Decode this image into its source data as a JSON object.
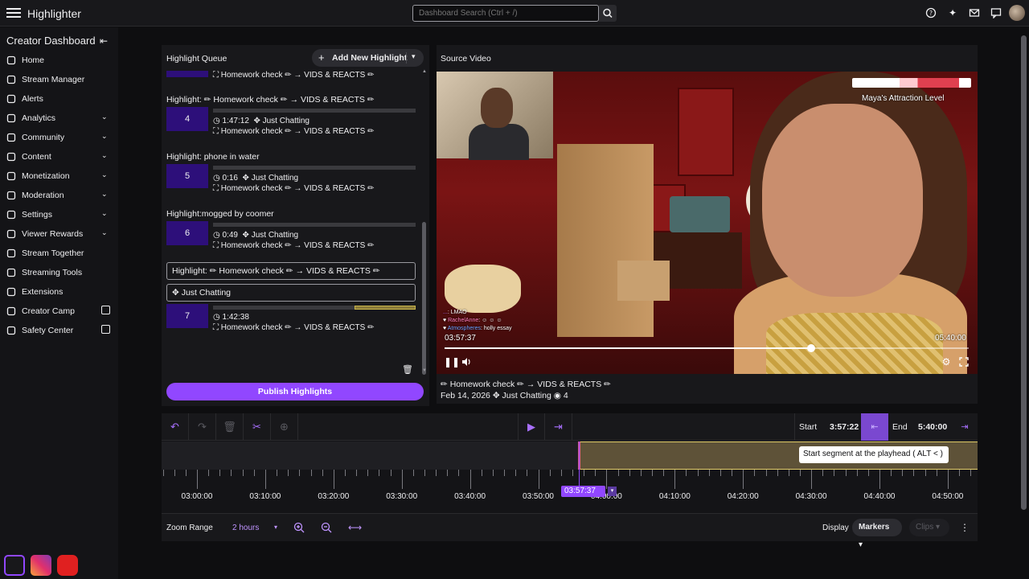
{
  "app": {
    "title": "Highlighter"
  },
  "search": {
    "placeholder": "Dashboard Search (Ctrl + /)"
  },
  "topbar_icons": [
    "help-icon",
    "sparkle-icon",
    "mail-icon",
    "chat-icon",
    "avatar"
  ],
  "sidebar": {
    "heading": "Creator Dashboard",
    "items": [
      {
        "label": "Home",
        "icon": "home-icon",
        "chevron": false,
        "external": false
      },
      {
        "label": "Stream Manager",
        "icon": "broadcast-icon",
        "chevron": false,
        "external": false
      },
      {
        "label": "Alerts",
        "icon": "megaphone-icon",
        "chevron": false,
        "external": false
      },
      {
        "label": "Analytics",
        "icon": "chart-icon",
        "chevron": true,
        "external": false
      },
      {
        "label": "Community",
        "icon": "community-icon",
        "chevron": true,
        "external": false
      },
      {
        "label": "Content",
        "icon": "content-icon",
        "chevron": true,
        "external": false
      },
      {
        "label": "Monetization",
        "icon": "money-icon",
        "chevron": true,
        "external": false
      },
      {
        "label": "Moderation",
        "icon": "sword-icon",
        "chevron": true,
        "external": false
      },
      {
        "label": "Settings",
        "icon": "gear-icon",
        "chevron": true,
        "external": false
      },
      {
        "label": "Viewer Rewards",
        "icon": "reward-icon",
        "chevron": true,
        "external": false
      },
      {
        "label": "Stream Together",
        "icon": "together-icon",
        "chevron": false,
        "external": false
      },
      {
        "label": "Streaming Tools",
        "icon": "tools-icon",
        "chevron": false,
        "external": false
      },
      {
        "label": "Extensions",
        "icon": "puzzle-icon",
        "chevron": false,
        "external": false
      },
      {
        "label": "Creator Camp",
        "icon": "book-icon",
        "chevron": false,
        "external": true
      },
      {
        "label": "Safety Center",
        "icon": "shield-icon",
        "chevron": false,
        "external": true
      }
    ]
  },
  "queue": {
    "title": "Highlight Queue",
    "add_label": "Add New Highlight",
    "publish_label": "Publish Highlights",
    "partial_meta": "Homework check ✏ → VIDS & REACTS ✏",
    "items": [
      {
        "title": "Highlight: ✏ Homework check ✏ → VIDS & REACTS ✏",
        "num": "4",
        "duration": "1:47:12",
        "category": "Just Chatting",
        "stream": "Homework check ✏ → VIDS & REACTS ✏",
        "fill_start": 0.0,
        "fill_end": 0.0
      },
      {
        "title": "Highlight: phone in water",
        "num": "5",
        "duration": "0:16",
        "category": "Just Chatting",
        "stream": "Homework check ✏ → VIDS & REACTS ✏",
        "fill_start": 0.0,
        "fill_end": 0.0
      },
      {
        "title": "Highlight:mogged by coomer",
        "num": "6",
        "duration": "0:49",
        "category": "Just Chatting",
        "stream": "Homework check ✏ → VIDS & REACTS ✏",
        "fill_start": 0.0,
        "fill_end": 0.0
      }
    ],
    "editing": {
      "title_value": "Highlight: ✏ Homework check ✏ → VIDS & REACTS ✏",
      "category_value": "Just Chatting",
      "num": "7",
      "duration": "1:42:38",
      "stream": "Homework check ✏ → VIDS & REACTS ✏",
      "fill_start": 0.7,
      "fill_end": 1.0
    }
  },
  "source": {
    "title": "Source Video",
    "overlay_label": "Maya's Attraction Level",
    "current_time": "03:57:37",
    "end_time": "05:40:00",
    "progress": 0.7,
    "chat": [
      {
        "user": "...",
        "msg": "LMAO"
      },
      {
        "user": "RachelAnne",
        "msg": ": ☺ ☺ ☺"
      },
      {
        "user": "Atmospheres",
        "msg": ": holly essay"
      }
    ],
    "stream_title": "✏ Homework check ✏ → VIDS & REACTS ✏",
    "date": "Feb 14, 2026",
    "category": "Just Chatting",
    "viewers": "4"
  },
  "timeline": {
    "start_label": "Start",
    "start_value": "3:57:22",
    "end_label": "End",
    "end_value": "5:40:00",
    "tooltip": "Start segment at the playhead ( ALT < )",
    "playhead": "03:57:37",
    "ticks": [
      "03:00:00",
      "03:10:00",
      "03:20:00",
      "03:30:00",
      "03:40:00",
      "03:50:00",
      "04:00:00",
      "04:10:00",
      "04:20:00",
      "04:30:00",
      "04:40:00",
      "04:50:00"
    ],
    "zoom_label": "Zoom Range",
    "zoom_value": "2 hours",
    "display_label": "Display",
    "markers_label": "Markers",
    "clips_label": "Clips"
  }
}
